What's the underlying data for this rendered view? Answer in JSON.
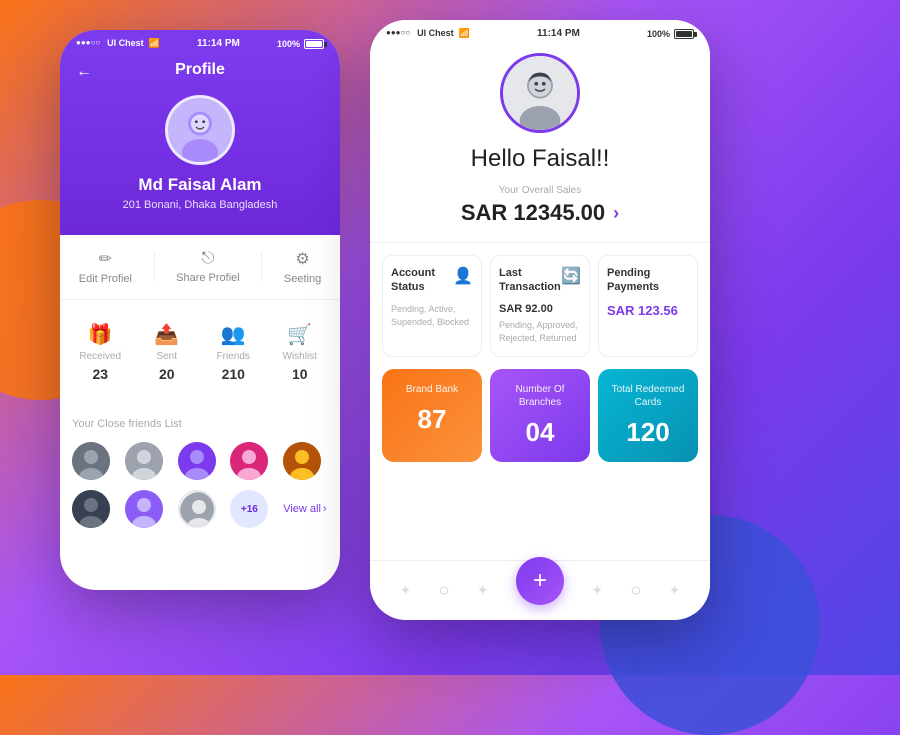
{
  "background": {
    "gradient_start": "#f97316",
    "gradient_end": "#4f46e5"
  },
  "left_phone": {
    "status_bar": {
      "dots": "●●●○○",
      "app_name": "UI Chest",
      "wifi_icon": "wifi",
      "time": "11:14 PM",
      "battery": "100%"
    },
    "header": {
      "back_label": "←",
      "title": "Profile"
    },
    "profile": {
      "name": "Md Faisal Alam",
      "address": "201 Bonani, Dhaka Bangladesh"
    },
    "actions": [
      {
        "icon": "✏️",
        "label": "Edit Profiel"
      },
      {
        "icon": "⎋",
        "label": "Share Profiel"
      },
      {
        "icon": "⚙️",
        "label": "Seeting"
      }
    ],
    "stats": [
      {
        "icon": "🎁",
        "label": "Received",
        "value": "23"
      },
      {
        "icon": "📤",
        "label": "Sent",
        "value": "20"
      },
      {
        "icon": "👥",
        "label": "Friends",
        "value": "210"
      },
      {
        "icon": "🛒",
        "label": "Wishlist",
        "value": "10"
      }
    ],
    "friends": {
      "title": "Your Close friends List",
      "view_all": "View all",
      "more_count": "+16"
    }
  },
  "right_phone": {
    "status_bar": {
      "dots": "●●●○○",
      "app_name": "UI Chest",
      "wifi_icon": "wifi",
      "time": "11:14 PM",
      "battery": "100%"
    },
    "greeting": "Hello Faisal!!",
    "sales": {
      "label": "Your Overall Sales",
      "amount": "SAR 12345.00",
      "arrow": "›"
    },
    "info_cards": [
      {
        "title": "Account Status",
        "icon": "👤",
        "sub_text": "Pending, Active, Supended, Blocked"
      },
      {
        "title": "Last Transaction",
        "icon": "🔄",
        "value": "SAR 92.00",
        "sub_text": "Pending, Approved, Rejected, Returned"
      },
      {
        "title": "Pending Payments",
        "icon": "",
        "value": "SAR 123.56",
        "is_colored": true
      }
    ],
    "colored_cards": [
      {
        "label": "Brand Bank",
        "value": "87",
        "color": "orange"
      },
      {
        "label": "Number Of Branches",
        "value": "04",
        "color": "purple"
      },
      {
        "label": "Total Redeemed Cards",
        "value": "120",
        "color": "teal"
      }
    ],
    "bottom_nav": {
      "items": [
        "✦",
        "○",
        "✦",
        "+",
        "✦",
        "○",
        "✦"
      ]
    }
  }
}
